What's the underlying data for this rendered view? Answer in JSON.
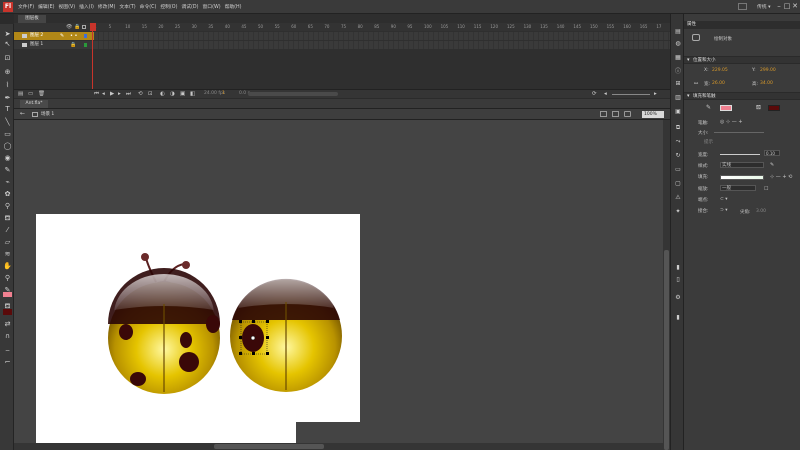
{
  "app": {
    "logo": "Fl",
    "menu": [
      "文件(F)",
      "编辑(E)",
      "视图(V)",
      "插入(I)",
      "修改(M)",
      "文本(T)",
      "命令(C)",
      "控制(O)",
      "调试(D)",
      "窗口(W)",
      "帮助(H)"
    ],
    "workspace_label": "传统 ▾",
    "doc_tab": "图层板",
    "window_controls": [
      "–",
      "□",
      "✕"
    ]
  },
  "timeline": {
    "ruler": [
      "1",
      "5",
      "10",
      "15",
      "20",
      "25",
      "30",
      "35",
      "40",
      "45",
      "50",
      "55",
      "60",
      "65",
      "70",
      "75",
      "80",
      "85",
      "90",
      "95",
      "100",
      "105",
      "110",
      "115",
      "120",
      "125",
      "130",
      "135",
      "140",
      "145",
      "150",
      "155",
      "160",
      "165",
      "17"
    ],
    "layers": [
      {
        "name": "图层 2",
        "selected": true,
        "swatch": "#3f6fd8"
      },
      {
        "name": "图层 1",
        "selected": false,
        "swatch": "#2a9a3a"
      }
    ],
    "footer": {
      "fps": "24.00 fps",
      "frame": "1",
      "time": "0.0 s"
    }
  },
  "editor": {
    "tab": "Ant.fla*",
    "scene": "场景 1",
    "zoom": "100%"
  },
  "properties": {
    "panel_title": "属性",
    "object_name": "绘制对象",
    "sections": {
      "position": "位置和大小",
      "fill_stroke": "填充和笔触"
    },
    "position": {
      "x_label": "X:",
      "x_value": "229.05",
      "y_label": "Y:",
      "y_value": "299.00",
      "w_label": "宽:",
      "w_value": "26.00",
      "h_label": "高:",
      "h_value": "34.00"
    },
    "fill_stroke": {
      "stroke_color": "#f08090",
      "fill_color": "#5a0a0a",
      "stroke_label": "笔触:",
      "size_label": "大小:",
      "hint_label": "提示",
      "width_label": "宽度:",
      "style_label": "样式:",
      "style_value": "实线",
      "stroke_size": "0.10",
      "zoom_label": "缩放:",
      "zoom_value": "一般",
      "cap_label": "端点:",
      "join_label": "接合:",
      "miter_label": "尖角:",
      "miter_value": "3.00",
      "fill_label": "填充:"
    }
  }
}
